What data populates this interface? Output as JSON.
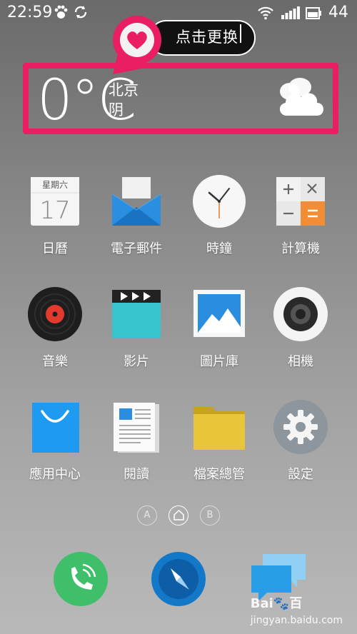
{
  "status_bar": {
    "time": "22:59",
    "battery": "44"
  },
  "tooltip": {
    "text": "点击更换"
  },
  "weather": {
    "temperature": "0°C",
    "city": "北京",
    "condition": "阴",
    "icon": "cloud-icon"
  },
  "apps": [
    {
      "label": "日曆",
      "icon": "calendar-icon",
      "calendar_weekday": "星期六",
      "calendar_day": "17"
    },
    {
      "label": "電子郵件",
      "icon": "email-icon"
    },
    {
      "label": "時鐘",
      "icon": "clock-icon"
    },
    {
      "label": "計算機",
      "icon": "calculator-icon"
    },
    {
      "label": "音樂",
      "icon": "music-icon"
    },
    {
      "label": "影片",
      "icon": "video-icon"
    },
    {
      "label": "圖片庫",
      "icon": "gallery-icon"
    },
    {
      "label": "相機",
      "icon": "camera-icon"
    },
    {
      "label": "應用中心",
      "icon": "app-store-icon"
    },
    {
      "label": "閱讀",
      "icon": "reader-icon"
    },
    {
      "label": "檔案總管",
      "icon": "folder-icon"
    },
    {
      "label": "設定",
      "icon": "settings-icon"
    }
  ],
  "pager": {
    "left": "A",
    "right": "B",
    "active": "home"
  },
  "dock": [
    {
      "icon": "phone-icon"
    },
    {
      "icon": "browser-compass-icon"
    },
    {
      "icon": "messages-icon"
    }
  ],
  "watermark": {
    "brand": "Bai",
    "brand_end": "百",
    "site": "jingyan.baidu.com"
  },
  "colors": {
    "highlight": "#e91e63",
    "tooltip_bg": "#111111"
  }
}
